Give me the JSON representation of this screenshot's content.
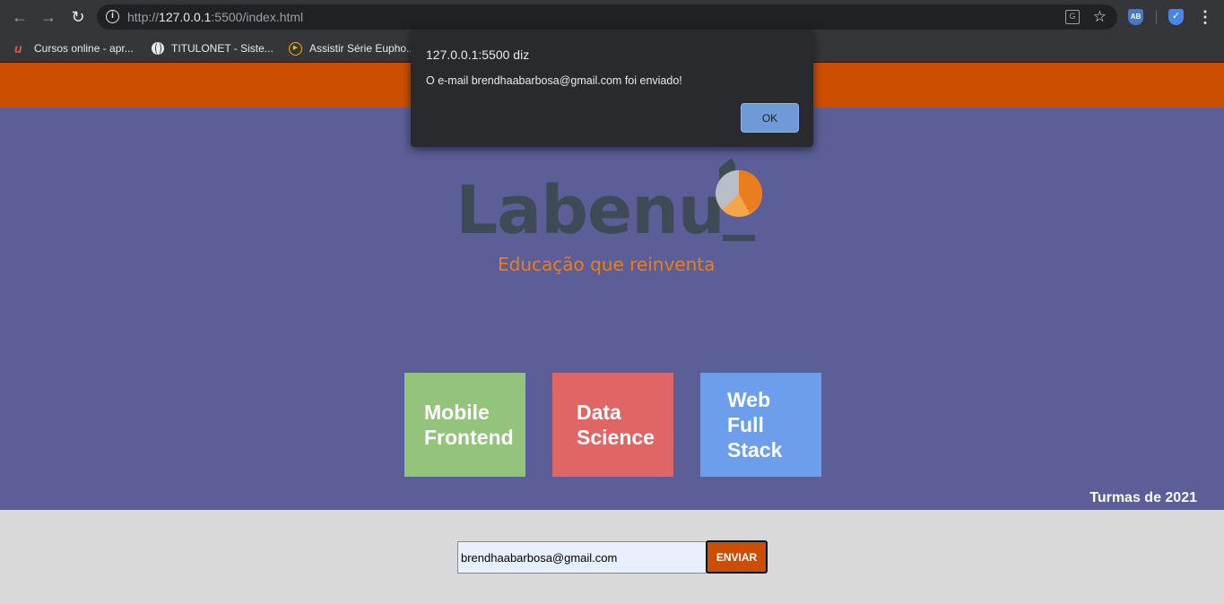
{
  "browser": {
    "url_scheme": "http://",
    "url_host": "127.0.0.1",
    "url_rest": ":5500/index.html",
    "icons": {
      "back": "arrow-left-icon",
      "forward": "arrow-right-icon",
      "reload": "reload-icon",
      "info": "info-icon",
      "translate": "translate-icon",
      "bookmark_star": "star-icon",
      "adblock": "adblock-extension-icon",
      "shield": "shield-extension-icon",
      "menu": "kebab-menu-icon"
    },
    "bookmarks": [
      {
        "label": "Cursos online - apr...",
        "icon": "udemy-icon"
      },
      {
        "label": "TITULONET - Siste...",
        "icon": "globe-icon"
      },
      {
        "label": "Assistir Série Eupho...",
        "icon": "play-icon"
      }
    ]
  },
  "page": {
    "brand": {
      "logo_word": "Labenu",
      "tagline": "Educação que reinventa"
    },
    "courses": [
      {
        "lines": [
          "Mobile",
          "Frontend"
        ],
        "color": "#94c47c"
      },
      {
        "lines": [
          "Data",
          "Science"
        ],
        "color": "#e06666"
      },
      {
        "lines": [
          "Web",
          "Full",
          "Stack"
        ],
        "color": "#6d9eeb"
      }
    ],
    "footer_note": "Turmas de 2021",
    "form": {
      "email_value": "brendhaabarbosa@gmail.com",
      "submit_label": "ENVIAR"
    },
    "colors": {
      "header_orange": "#cc4e00",
      "hero_purple": "#5c5e97",
      "footer_gray": "#d9d9d9"
    }
  },
  "dialog": {
    "title": "127.0.0.1:5500 diz",
    "message": "O e-mail brendhaabarbosa@gmail.com foi enviado!",
    "ok_label": "OK"
  }
}
